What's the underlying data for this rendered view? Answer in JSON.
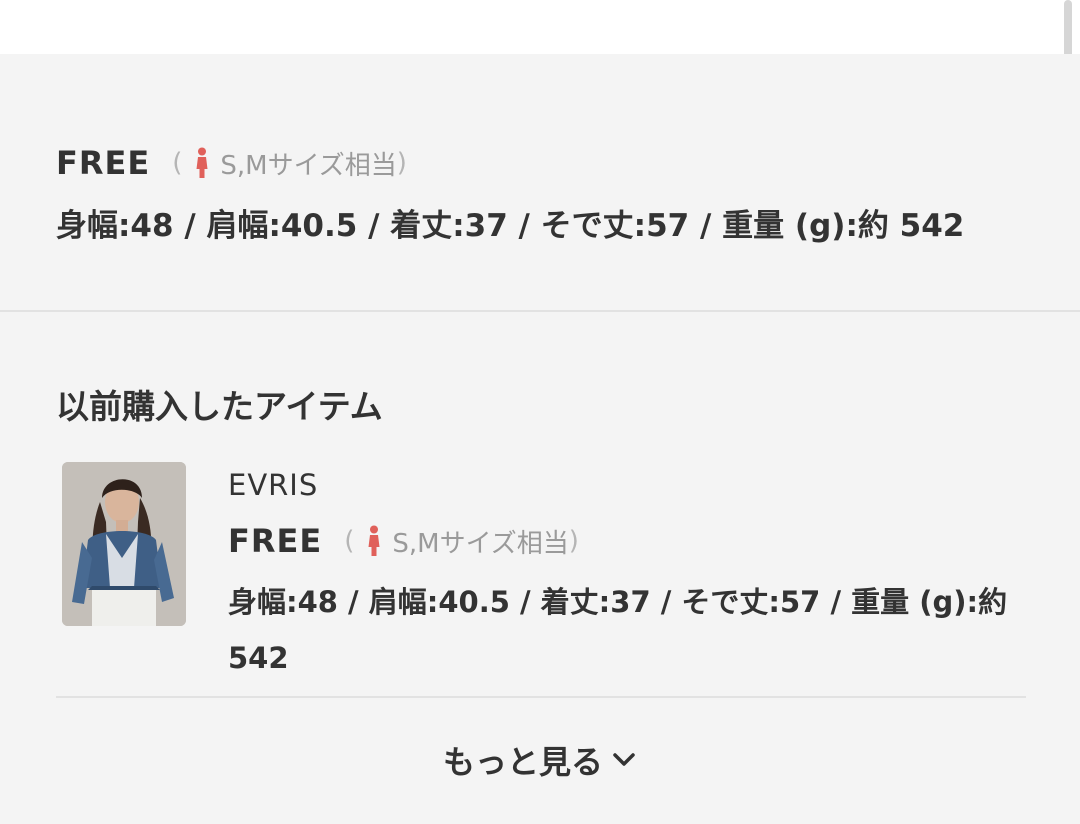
{
  "current_size": {
    "size_label": "FREE",
    "paren_open": "(",
    "size_fit": "S,Mサイズ相当",
    "paren_close": ")",
    "measurements": "身幅:48 / 肩幅:40.5 / 着丈:37 / そで丈:57 / 重量 (g):約 542",
    "icon": "person-female-icon",
    "icon_color": "#e0605a"
  },
  "history": {
    "title": "以前購入したアイテム",
    "items": [
      {
        "brand": "EVRIS",
        "size_label": "FREE",
        "paren_open": "(",
        "size_fit": "S,Mサイズ相当",
        "paren_close": ")",
        "measurements": "身幅:48 / 肩幅:40.5 / 着丈:37 / そで丈:57 / 重量 (g):約 542",
        "thumbnail": "product-photo-denim-jacket"
      }
    ],
    "more_label": "もっと見る",
    "more_icon": "chevron-down-icon"
  }
}
